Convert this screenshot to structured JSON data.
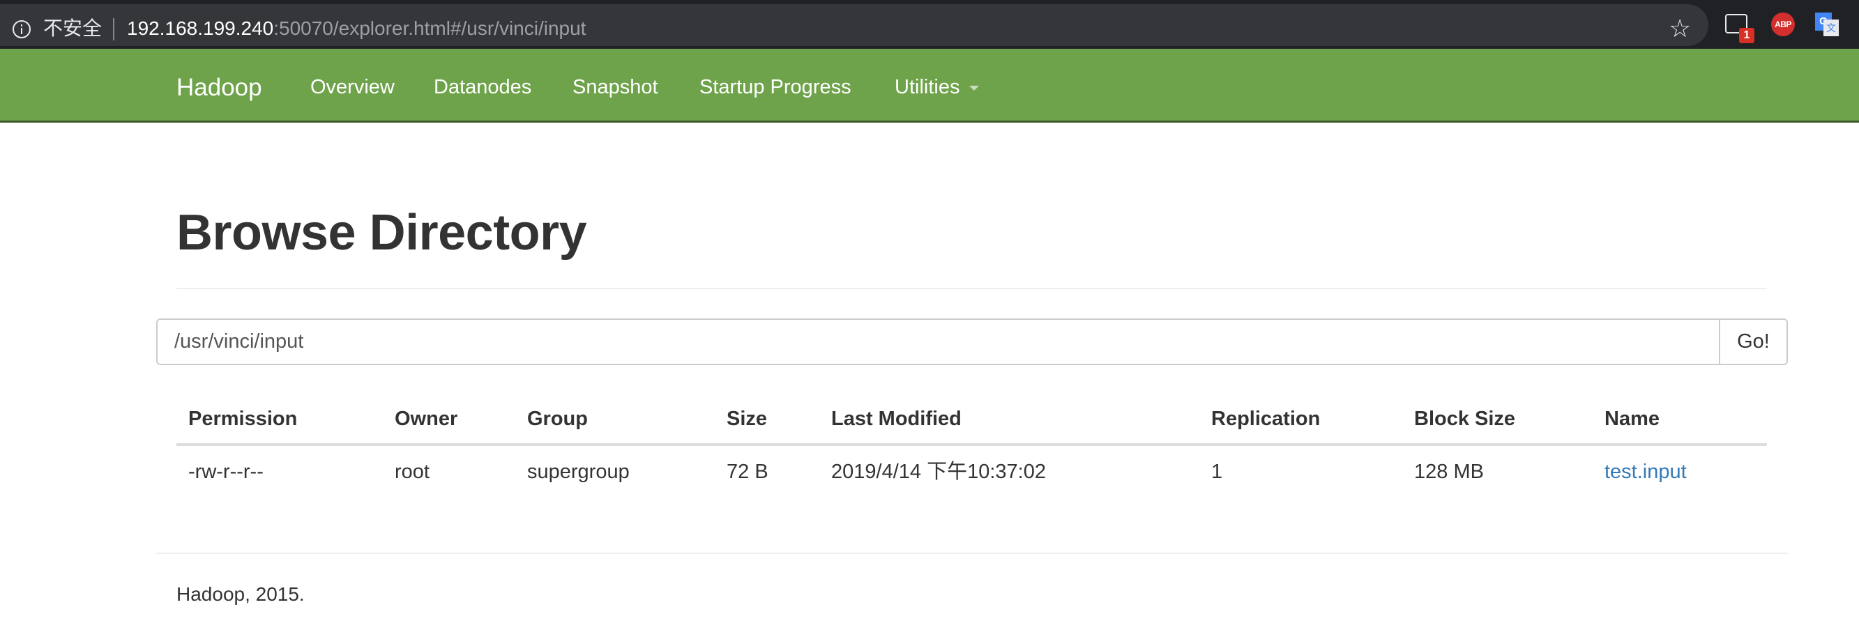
{
  "browser": {
    "security_label": "不安全",
    "url_host": "192.168.199.240",
    "url_path": ":50070/explorer.html#/usr/vinci/input",
    "bookmark_icon": "star-icon",
    "extensions": {
      "cast_badge": "1",
      "abp_label": "ABP",
      "translate_g": "G",
      "translate_t": "文"
    }
  },
  "navbar": {
    "brand": "Hadoop",
    "items": [
      {
        "label": "Overview"
      },
      {
        "label": "Datanodes"
      },
      {
        "label": "Snapshot"
      },
      {
        "label": "Startup Progress"
      },
      {
        "label": "Utilities"
      }
    ],
    "color": "#6fa34b"
  },
  "page": {
    "title": "Browse Directory",
    "path_value": "/usr/vinci/input",
    "go_label": "Go!"
  },
  "table": {
    "headers": [
      "Permission",
      "Owner",
      "Group",
      "Size",
      "Last Modified",
      "Replication",
      "Block Size",
      "Name"
    ],
    "rows": [
      {
        "permission": "-rw-r--r--",
        "owner": "root",
        "group": "supergroup",
        "size": "72 B",
        "last_modified": "2019/4/14 下午10:37:02",
        "replication": "1",
        "block_size": "128 MB",
        "name": "test.input"
      }
    ],
    "link_color": "#337ab7"
  },
  "footer": {
    "text": "Hadoop, 2015."
  }
}
